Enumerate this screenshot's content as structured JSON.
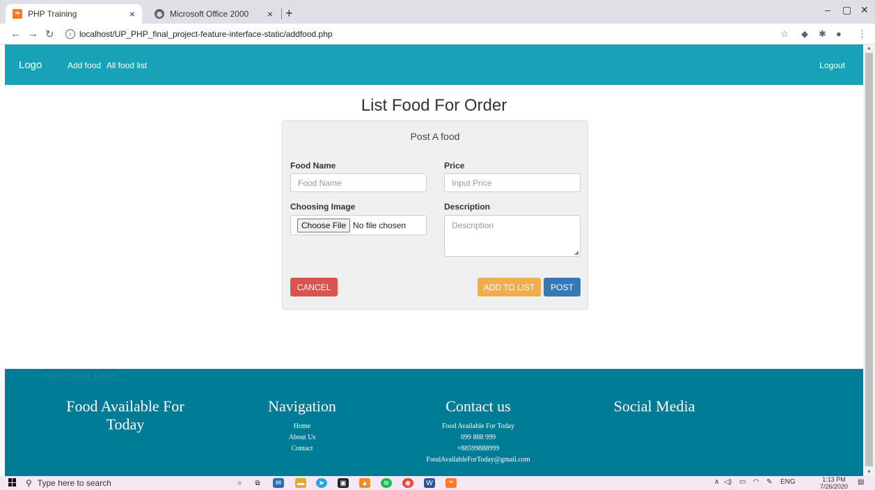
{
  "browser": {
    "tabs": [
      {
        "title": "PHP Training",
        "favicon": "xampp-icon"
      },
      {
        "title": "Microsoft Office 2000",
        "favicon": "globe-icon"
      }
    ],
    "close_glyph": "×",
    "new_tab_glyph": "+",
    "url": "localhost/UP_PHP_final_project-feature-interface-static/addfood.php"
  },
  "navbar": {
    "logo": "Logo",
    "links": [
      "Add food",
      "All food list"
    ],
    "logout": "Logout"
  },
  "page": {
    "title": "List Food For Order"
  },
  "form": {
    "card_title": "Post A food",
    "food_name_label": "Food Name",
    "food_name_placeholder": "Food Name",
    "price_label": "Price",
    "price_placeholder": "Input Price",
    "image_label": "Choosing Image",
    "choose_file_label": "Choose File",
    "no_file_text": "No file chosen",
    "description_label": "Description",
    "description_placeholder": "Description",
    "cancel_label": "CANCEL",
    "add_to_list_label": "ADD TO LIST",
    "post_label": "POST"
  },
  "footer": {
    "copyright": "© SabuyTraining, Laravel",
    "col1_head": "Food Available For Today",
    "nav_head": "Navigation",
    "nav_items": [
      "Home",
      "About Us",
      "Contact"
    ],
    "contact_head": "Contact us",
    "contact_items": [
      "Food Available For Today",
      "099 888 999",
      "+88599888999",
      "FoodAvailableForToday@gmail.com"
    ],
    "social_head": "Social Media"
  },
  "taskbar": {
    "search_placeholder": "Type here to search",
    "lang": "ENG",
    "time": "1:13 PM",
    "date": "7/26/2020"
  },
  "colors": {
    "navbar": "#17a2b8",
    "footer": "#007b95",
    "cancel": "#d9534f",
    "add_to_list": "#f0ad4e",
    "post": "#337ab7"
  }
}
